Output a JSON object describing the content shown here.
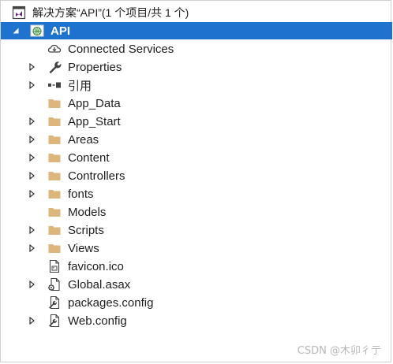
{
  "solution": {
    "label": "解决方案“API”(1 个项目/共 1 个)",
    "icon": "vs-solution-icon"
  },
  "project": {
    "label": "API",
    "icon": "web-project-globe-icon",
    "expanded": true,
    "selected": true
  },
  "items": [
    {
      "label": "Connected Services",
      "icon": "cloud-connected-icon",
      "expandable": false
    },
    {
      "label": "Properties",
      "icon": "wrench-icon",
      "expandable": true
    },
    {
      "label": "引用",
      "icon": "references-icon",
      "expandable": true
    },
    {
      "label": "App_Data",
      "icon": "folder-icon",
      "expandable": false
    },
    {
      "label": "App_Start",
      "icon": "folder-icon",
      "expandable": true
    },
    {
      "label": "Areas",
      "icon": "folder-icon",
      "expandable": true
    },
    {
      "label": "Content",
      "icon": "folder-icon",
      "expandable": true
    },
    {
      "label": "Controllers",
      "icon": "folder-icon",
      "expandable": true
    },
    {
      "label": "fonts",
      "icon": "folder-icon",
      "expandable": true
    },
    {
      "label": "Models",
      "icon": "folder-icon",
      "expandable": false
    },
    {
      "label": "Scripts",
      "icon": "folder-icon",
      "expandable": true
    },
    {
      "label": "Views",
      "icon": "folder-icon",
      "expandable": true
    },
    {
      "label": "favicon.ico",
      "icon": "ico-file-icon",
      "expandable": false
    },
    {
      "label": "Global.asax",
      "icon": "asax-gear-file-icon",
      "expandable": true
    },
    {
      "label": "packages.config",
      "icon": "config-file-icon",
      "expandable": false
    },
    {
      "label": "Web.config",
      "icon": "config-file-icon",
      "expandable": true
    }
  ],
  "watermark": "CSDN @木卯彳亍",
  "colors": {
    "selection": "#1e73cf",
    "folder": "#dcb67a",
    "expander": "#1e1e1e"
  }
}
